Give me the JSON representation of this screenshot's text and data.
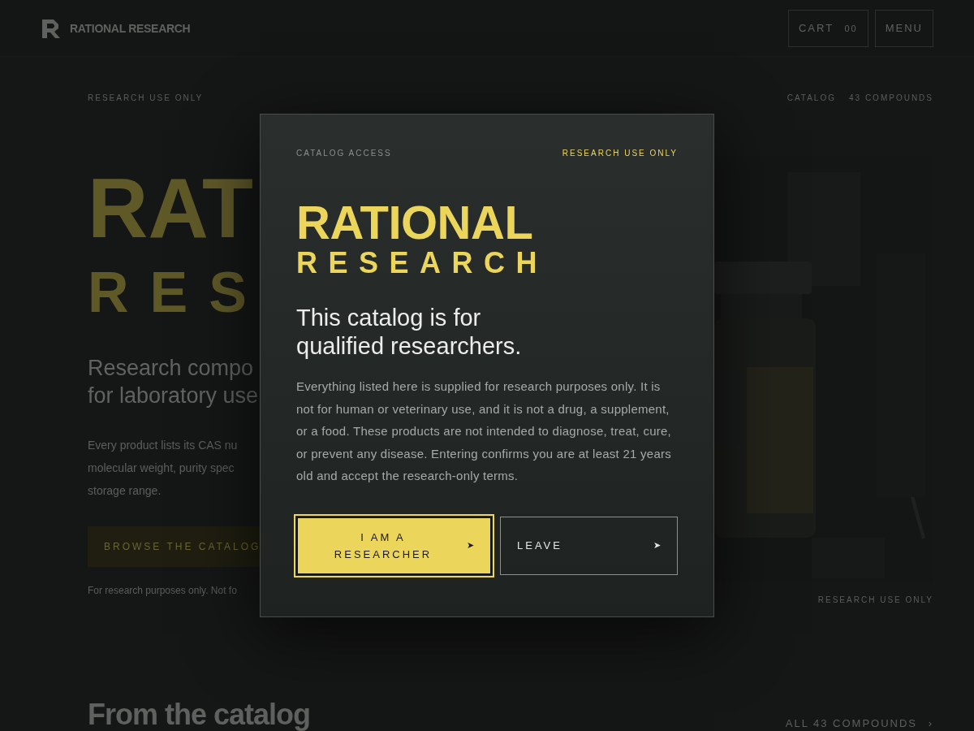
{
  "header": {
    "brand": "RATIONAL RESEARCH",
    "cart": {
      "label": "CART",
      "count": "00"
    },
    "menu": "MENU"
  },
  "subbar": {
    "left": "RESEARCH USE ONLY",
    "right": [
      "CATALOG",
      "43 COMPOUNDS"
    ]
  },
  "hero": {
    "wordmark": [
      "RAT",
      "RES"
    ],
    "headline": [
      "Research compo",
      "for laboratory use"
    ],
    "body": [
      "Every product lists its CAS nu",
      "molecular weight, purity spec",
      "storage range."
    ],
    "button": "BROWSE THE CATALOG",
    "footnote": "For research purposes only. Not fo",
    "image": {
      "kind": "picture"
    },
    "image_caption": "RESEARCH USE ONLY"
  },
  "section": {
    "title": "From the catalog",
    "link": "ALL 43 COMPOUNDS",
    "link_icon": "›"
  },
  "modal": {
    "eyebrow": "CATALOG ACCESS",
    "tag": "RESEARCH USE ONLY",
    "logo": [
      "RATIONAL",
      "RESEARCH"
    ],
    "title": "This catalog is for qualified researchers.",
    "body": "Everything listed here is supplied for research purposes only. It is not for human or veterinary use, and it is not a drug, a supplement, or a food. These products are not intended to diagnose, treat, cure, or prevent any disease. Entering confirms you are at least 21 years old and accept the research-only terms.",
    "buttons": [
      {
        "label": "I AM A RESEARCHER",
        "icon": "➤",
        "kind": "primary",
        "focused": true
      },
      {
        "label": "LEAVE",
        "icon": "➤",
        "kind": "secondary",
        "focused": false
      }
    ]
  }
}
